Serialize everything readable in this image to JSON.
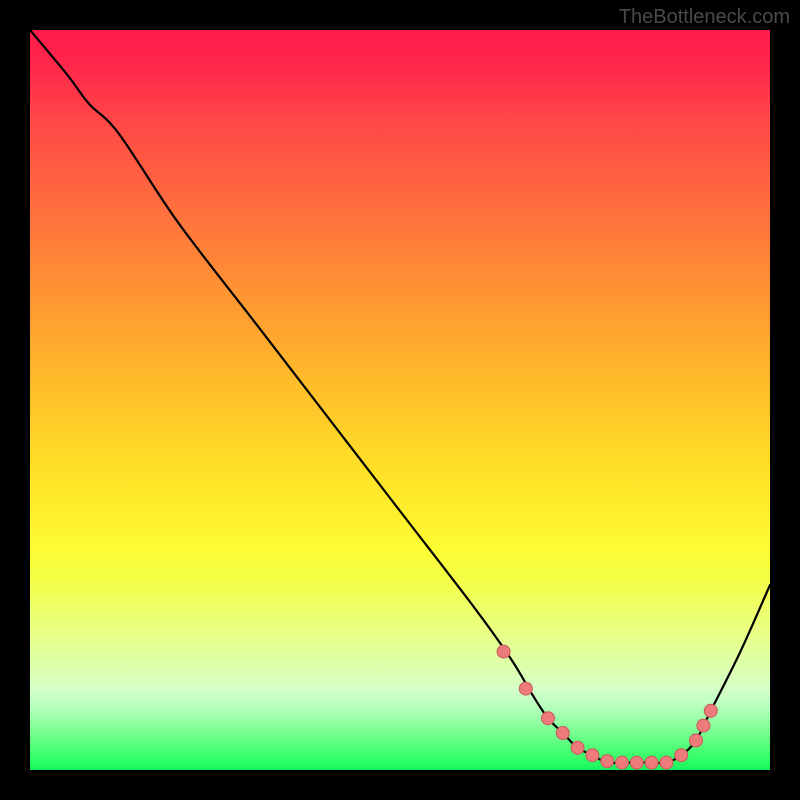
{
  "watermark": "TheBottleneck.com",
  "colors": {
    "background": "#000000",
    "line": "#000000",
    "marker_fill": "#ee7b7b",
    "marker_stroke": "#c85a5a"
  },
  "chart_data": {
    "type": "line",
    "title": "",
    "xlabel": "",
    "ylabel": "",
    "xlim": [
      0,
      100
    ],
    "ylim": [
      0,
      100
    ],
    "series": [
      {
        "name": "bottleneck-curve",
        "x": [
          0,
          5,
          8,
          12,
          20,
          30,
          40,
          50,
          60,
          65,
          68,
          70,
          72,
          74,
          76,
          78,
          80,
          82,
          84,
          86,
          88,
          90,
          92,
          96,
          100
        ],
        "y": [
          100,
          94,
          90,
          86,
          74,
          61,
          48,
          35,
          22,
          15,
          10,
          7,
          5,
          3,
          2,
          1,
          1,
          1,
          1,
          1,
          2,
          4,
          8,
          16,
          25
        ]
      }
    ],
    "markers": {
      "name": "highlight-points",
      "x": [
        64,
        67,
        70,
        72,
        74,
        76,
        78,
        80,
        82,
        84,
        86,
        88,
        90,
        91,
        92
      ],
      "y": [
        16,
        11,
        7,
        5,
        3,
        2,
        1.2,
        1,
        1,
        1,
        1,
        2,
        4,
        6,
        8
      ]
    }
  }
}
